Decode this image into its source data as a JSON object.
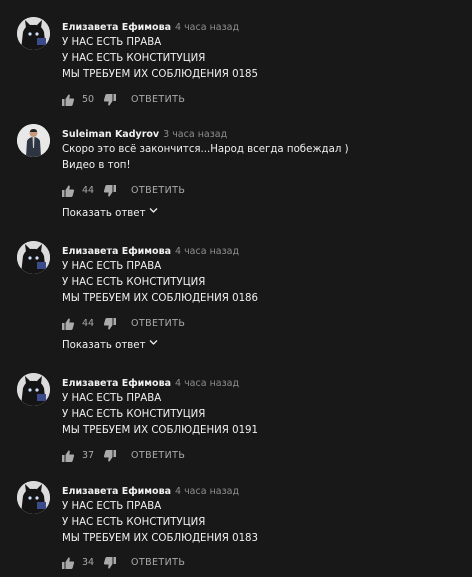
{
  "colors": {
    "background": "#181818",
    "text": "#f1f1f1",
    "muted": "#aaaaaa",
    "timestamp": "#8e8e8e"
  },
  "reply_label": "ОТВЕТИТЬ",
  "comments": [
    {
      "author": "Елизавета Ефимова",
      "time": "4 часа назад",
      "lines": [
        "У НАС ЕСТЬ ПРАВА",
        "У НАС ЕСТЬ КОНСТИТУЦИЯ",
        "МЫ ТРЕБУЕМ ИХ СОБЛЮДЕНИЯ 0185"
      ],
      "likes": "50",
      "avatar_icon": "black-cat-avatar-icon"
    },
    {
      "author": "Suleiman Kadyrov",
      "time": "3 часа назад",
      "lines": [
        "Скоро это всё закончится...Народ всегда побеждал )",
        "Видео в топ!"
      ],
      "likes": "44",
      "avatar_icon": "person-photo-avatar-icon",
      "show_replies": "Показать ответ"
    },
    {
      "author": "Елизавета Ефимова",
      "time": "4 часа назад",
      "lines": [
        "У НАС ЕСТЬ ПРАВА",
        "У НАС ЕСТЬ КОНСТИТУЦИЯ",
        "МЫ ТРЕБУЕМ ИХ СОБЛЮДЕНИЯ 0186"
      ],
      "likes": "44",
      "avatar_icon": "black-cat-avatar-icon",
      "show_replies": "Показать ответ"
    },
    {
      "author": "Елизавета Ефимова",
      "time": "4 часа назад",
      "lines": [
        "У НАС ЕСТЬ ПРАВА",
        "У НАС ЕСТЬ КОНСТИТУЦИЯ",
        "МЫ ТРЕБУЕМ ИХ СОБЛЮДЕНИЯ 0191"
      ],
      "likes": "37",
      "avatar_icon": "black-cat-avatar-icon"
    },
    {
      "author": "Елизавета Ефимова",
      "time": "4 часа назад",
      "lines": [
        "У НАС ЕСТЬ ПРАВА",
        "У НАС ЕСТЬ КОНСТИТУЦИЯ",
        "МЫ ТРЕБУЕМ ИХ СОБЛЮДЕНИЯ 0183"
      ],
      "likes": "34",
      "avatar_icon": "black-cat-avatar-icon"
    }
  ]
}
